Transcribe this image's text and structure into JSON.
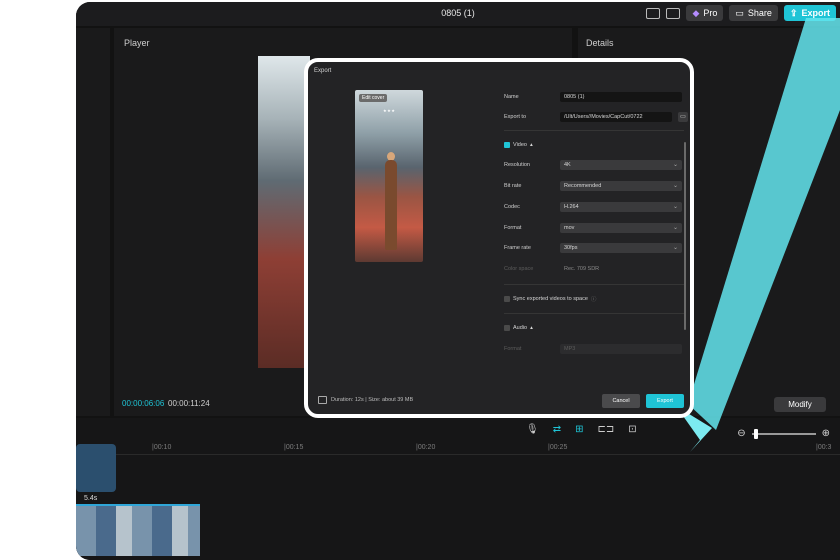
{
  "app": {
    "project_title": "0805 (1)",
    "pro_label": "Pro",
    "share_label": "Share",
    "export_label": "Export"
  },
  "player": {
    "title": "Player",
    "current_time": "00:00:06:06",
    "total_time": "00:00:11:24"
  },
  "details": {
    "title": "Details",
    "modify_label": "Modify"
  },
  "timeline": {
    "ticks": [
      "|00:10",
      "|00:15",
      "|00:20",
      "|00:25",
      "|00:3"
    ],
    "clip_duration": "5.4s"
  },
  "export_dialog": {
    "title": "Export",
    "edit_cover": "Edit cover",
    "name_label": "Name",
    "name_value": "0805 (1)",
    "export_to_label": "Export to",
    "export_to_value": "/Ult/Users//Movies/CapCut/0722",
    "video_section": "Video",
    "resolution_label": "Resolution",
    "resolution_value": "4K",
    "bitrate_label": "Bit rate",
    "bitrate_value": "Recommended",
    "codec_label": "Codec",
    "codec_value": "H.264",
    "format_label": "Format",
    "format_value": "mov",
    "framerate_label": "Frame rate",
    "framerate_value": "30fps",
    "colorspace_label": "Color space",
    "colorspace_value": "Rec. 709 SDR",
    "sync_label": "Sync exported videos to space",
    "audio_section": "Audio",
    "audio_format_label": "Format",
    "audio_format_value": "MP3",
    "footer_info": "Duration: 12s | Size: about 39 MB",
    "cancel_label": "Cancel",
    "export_label": "Export"
  }
}
